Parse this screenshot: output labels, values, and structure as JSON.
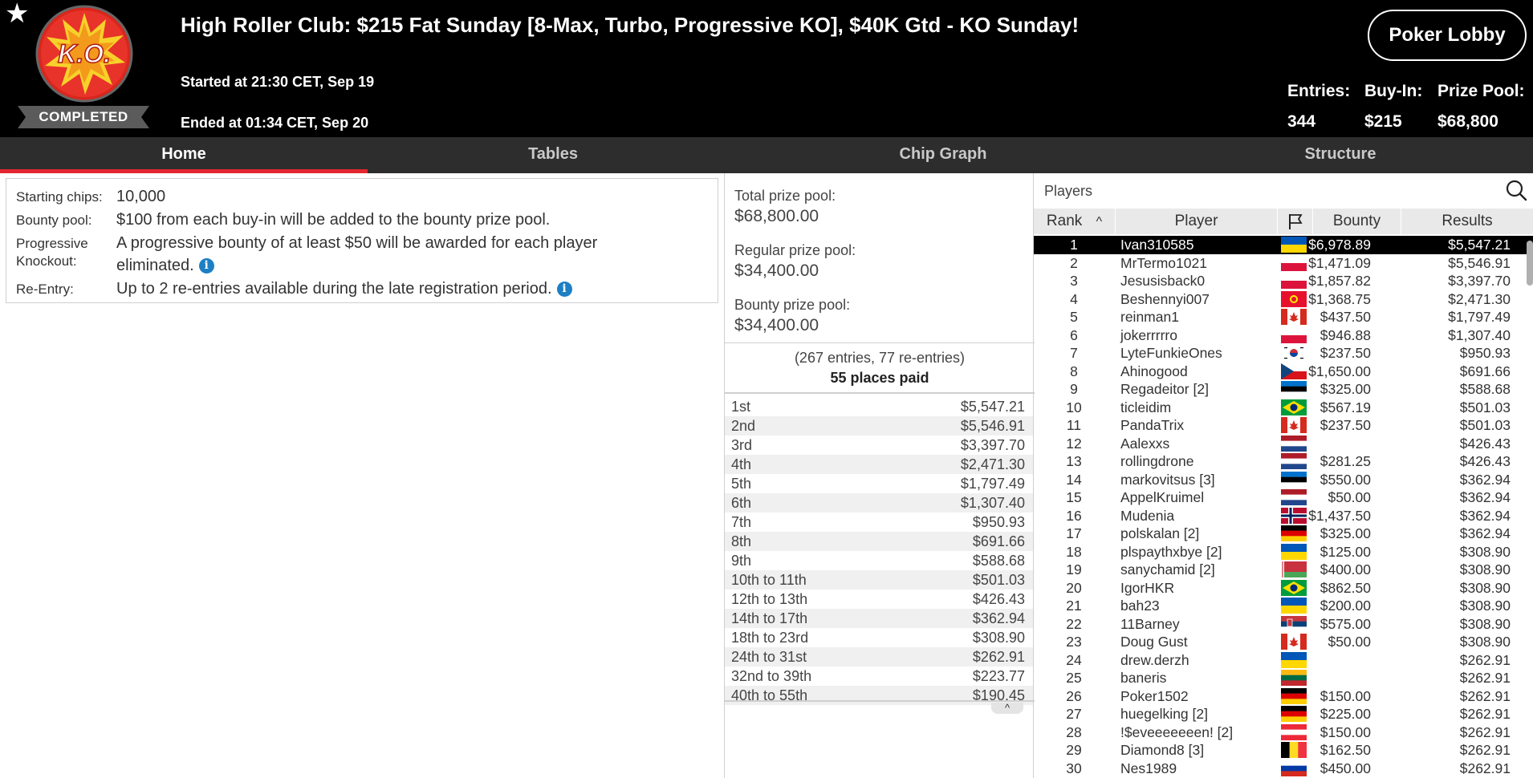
{
  "header": {
    "title": "High Roller Club: $215 Fat Sunday [8-Max, Turbo, Progressive KO], $40K Gtd - KO Sunday!",
    "logo_text": "K.O.",
    "status": "COMPLETED",
    "started": "Started at 21:30 CET, Sep 19",
    "ended": "Ended at 01:34 CET, Sep 20",
    "lobby_button": "Poker Lobby",
    "entries_label": "Entries:",
    "entries_value": "344",
    "buyin_label": "Buy-In:",
    "buyin_value": "$215",
    "prizepool_label": "Prize Pool:",
    "prizepool_value": "$68,800",
    "icons": {
      "favorite": "star-icon",
      "logo": "ko-logo"
    },
    "colors": {
      "background": "#000000",
      "logo_red": "#d9261c",
      "logo_yellow": "#f7d12a"
    }
  },
  "tabs": {
    "items": [
      "Home",
      "Tables",
      "Chip Graph",
      "Structure"
    ],
    "active": "Home",
    "accent": "#e3262f"
  },
  "info": {
    "starting_chips_label": "Starting chips:",
    "starting_chips_value": "10,000",
    "bounty_pool_label": "Bounty pool:",
    "bounty_pool_value": "$100 from each buy-in will be added to the bounty prize pool.",
    "progressive_label_1": "Progressive",
    "progressive_label_2": "Knockout:",
    "progressive_value_1": "A progressive bounty of at least $50 will be awarded for each player",
    "progressive_value_2": "eliminated.",
    "reentry_label": "Re-Entry:",
    "reentry_value": "Up to 2 re-entries available during the late registration period.",
    "info_icon": "i"
  },
  "prizes": {
    "total_label": "Total prize pool:",
    "total_value": "$68,800.00",
    "regular_label": "Regular prize pool:",
    "regular_value": "$34,400.00",
    "bounty_label": "Bounty prize pool:",
    "bounty_value": "$34,400.00",
    "entries_line": "(267 entries, 77 re-entries)",
    "places_paid": "55 places paid",
    "collapse_icon": "^",
    "payouts": [
      {
        "place": "1st",
        "amount": "$5,547.21"
      },
      {
        "place": "2nd",
        "amount": "$5,546.91"
      },
      {
        "place": "3rd",
        "amount": "$3,397.70"
      },
      {
        "place": "4th",
        "amount": "$2,471.30"
      },
      {
        "place": "5th",
        "amount": "$1,797.49"
      },
      {
        "place": "6th",
        "amount": "$1,307.40"
      },
      {
        "place": "7th",
        "amount": "$950.93"
      },
      {
        "place": "8th",
        "amount": "$691.66"
      },
      {
        "place": "9th",
        "amount": "$588.68"
      },
      {
        "place": "10th to 11th",
        "amount": "$501.03"
      },
      {
        "place": "12th to 13th",
        "amount": "$426.43"
      },
      {
        "place": "14th to 17th",
        "amount": "$362.94"
      },
      {
        "place": "18th to 23rd",
        "amount": "$308.90"
      },
      {
        "place": "24th to 31st",
        "amount": "$262.91"
      },
      {
        "place": "32nd to 39th",
        "amount": "$223.77"
      },
      {
        "place": "40th to 55th",
        "amount": "$190.45"
      }
    ]
  },
  "players": {
    "title": "Players",
    "columns": {
      "rank": "Rank",
      "sort_icon": "^",
      "player": "Player",
      "flag_icon": "flag-icon",
      "bounty": "Bounty",
      "results": "Results"
    },
    "rows": [
      {
        "rank": "1",
        "name": "Ivan310585",
        "flag": "ukraine",
        "bounty": "$6,978.89",
        "result": "$5,547.21"
      },
      {
        "rank": "2",
        "name": "MrTermo1021",
        "flag": "poland",
        "bounty": "$1,471.09",
        "result": "$5,546.91"
      },
      {
        "rank": "3",
        "name": "Jesusisback0",
        "flag": "poland",
        "bounty": "$1,857.82",
        "result": "$3,397.70"
      },
      {
        "rank": "4",
        "name": "Beshennyi007",
        "flag": "kyrgyzstan",
        "bounty": "$1,368.75",
        "result": "$2,471.30"
      },
      {
        "rank": "5",
        "name": "reinman1",
        "flag": "canada",
        "bounty": "$437.50",
        "result": "$1,797.49"
      },
      {
        "rank": "6",
        "name": "jokerrrrro",
        "flag": "poland",
        "bounty": "$946.88",
        "result": "$1,307.40"
      },
      {
        "rank": "7",
        "name": "LyteFunkieOnes",
        "flag": "south-korea",
        "bounty": "$237.50",
        "result": "$950.93"
      },
      {
        "rank": "8",
        "name": "Ahinogood",
        "flag": "czech",
        "bounty": "$1,650.00",
        "result": "$691.66"
      },
      {
        "rank": "9",
        "name": "Regadeitor [2]",
        "flag": "estonia",
        "bounty": "$325.00",
        "result": "$588.68"
      },
      {
        "rank": "10",
        "name": "ticleidim",
        "flag": "brazil",
        "bounty": "$567.19",
        "result": "$501.03"
      },
      {
        "rank": "11",
        "name": "PandaTrix",
        "flag": "canada",
        "bounty": "$237.50",
        "result": "$501.03"
      },
      {
        "rank": "12",
        "name": "Aalexxs",
        "flag": "netherlands",
        "bounty": "",
        "result": "$426.43"
      },
      {
        "rank": "13",
        "name": "rollingdrone",
        "flag": "netherlands",
        "bounty": "$281.25",
        "result": "$426.43"
      },
      {
        "rank": "14",
        "name": "markovitsus [3]",
        "flag": "estonia",
        "bounty": "$550.00",
        "result": "$362.94"
      },
      {
        "rank": "15",
        "name": "AppelKruimel",
        "flag": "netherlands",
        "bounty": "$50.00",
        "result": "$362.94"
      },
      {
        "rank": "16",
        "name": "Mudenia",
        "flag": "norway",
        "bounty": "$1,437.50",
        "result": "$362.94"
      },
      {
        "rank": "17",
        "name": "polskalan [2]",
        "flag": "germany",
        "bounty": "$325.00",
        "result": "$362.94"
      },
      {
        "rank": "18",
        "name": "plspaythxbye [2]",
        "flag": "ukraine",
        "bounty": "$125.00",
        "result": "$308.90"
      },
      {
        "rank": "19",
        "name": "sanychamid [2]",
        "flag": "belarus",
        "bounty": "$400.00",
        "result": "$308.90"
      },
      {
        "rank": "20",
        "name": "IgorHKR",
        "flag": "brazil",
        "bounty": "$862.50",
        "result": "$308.90"
      },
      {
        "rank": "21",
        "name": "bah23",
        "flag": "ukraine",
        "bounty": "$200.00",
        "result": "$308.90"
      },
      {
        "rank": "22",
        "name": "11Barney",
        "flag": "serbia",
        "bounty": "$575.00",
        "result": "$308.90"
      },
      {
        "rank": "23",
        "name": "Doug Gust",
        "flag": "canada",
        "bounty": "$50.00",
        "result": "$308.90"
      },
      {
        "rank": "24",
        "name": "drew.derzh",
        "flag": "ukraine",
        "bounty": "",
        "result": "$262.91"
      },
      {
        "rank": "25",
        "name": "baneris",
        "flag": "lithuania",
        "bounty": "",
        "result": "$262.91"
      },
      {
        "rank": "26",
        "name": "Poker1502",
        "flag": "germany",
        "bounty": "$150.00",
        "result": "$262.91"
      },
      {
        "rank": "27",
        "name": "huegelking [2]",
        "flag": "germany",
        "bounty": "$225.00",
        "result": "$262.91"
      },
      {
        "rank": "28",
        "name": "!$eveeeeeeen! [2]",
        "flag": "austria",
        "bounty": "$150.00",
        "result": "$262.91"
      },
      {
        "rank": "29",
        "name": "Diamond8 [3]",
        "flag": "belgium",
        "bounty": "$162.50",
        "result": "$262.91"
      },
      {
        "rank": "30",
        "name": "Nes1989",
        "flag": "russia",
        "bounty": "$450.00",
        "result": "$262.91"
      }
    ]
  }
}
